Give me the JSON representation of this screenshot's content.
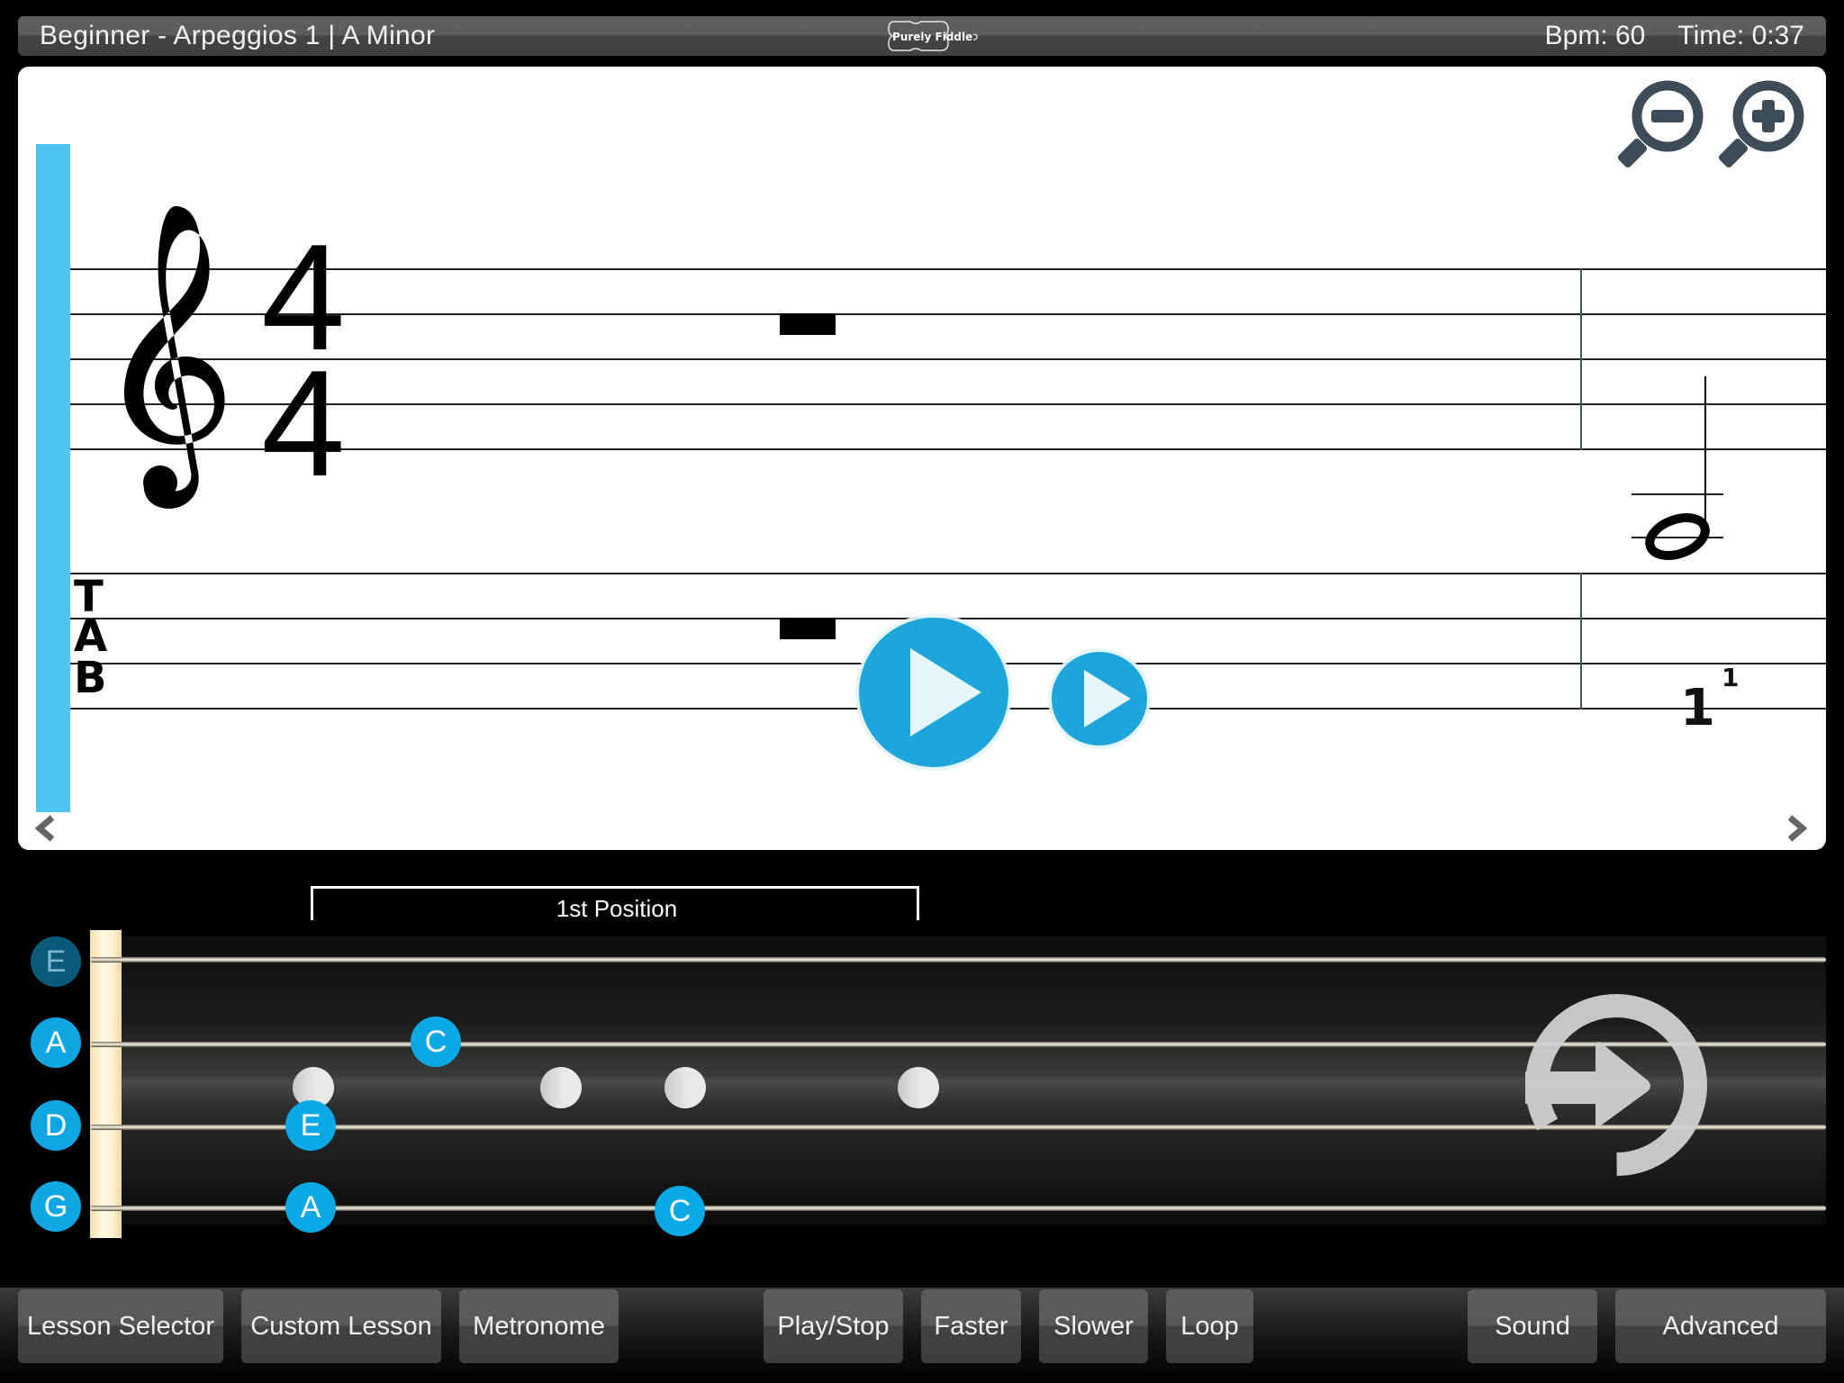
{
  "header": {
    "lesson_title": "Beginner - Arpeggios 1  |  A Minor",
    "logo_text": "Purely Fiddle",
    "bpm_label": "Bpm: 60",
    "time_label": "Time: 0:37"
  },
  "score": {
    "clef": "treble-clef",
    "time_signature": {
      "top": "4",
      "bottom": "4"
    },
    "tab_label": [
      "T",
      "A",
      "B"
    ],
    "measure1_rest": "whole-rest",
    "measure2_note": {
      "type": "half-note",
      "tab_fret": "1",
      "finger": "1"
    },
    "zoom_out_icon": "zoom-out-icon",
    "zoom_in_icon": "zoom-in-icon",
    "prev_icon": "chevron-left-icon",
    "next_icon": "chevron-right-icon",
    "play_icon": "play-icon",
    "play_slow_icon": "play-icon"
  },
  "fingerboard": {
    "position_label": "1st Position",
    "strings": [
      {
        "name": "E",
        "active": false
      },
      {
        "name": "A",
        "active": true
      },
      {
        "name": "D",
        "active": true
      },
      {
        "name": "G",
        "active": true
      }
    ],
    "notes": [
      {
        "string": "A",
        "label": "C"
      },
      {
        "string": "D",
        "label": "E"
      },
      {
        "string": "G",
        "label": "A"
      },
      {
        "string": "G",
        "label": "C"
      }
    ],
    "next_icon": "next-arrow-circle-icon"
  },
  "toolbar": {
    "lesson_selector": "Lesson Selector",
    "custom_lesson": "Custom Lesson",
    "metronome": "Metronome",
    "play_stop": "Play/Stop",
    "faster": "Faster",
    "slower": "Slower",
    "loop": "Loop",
    "sound": "Sound",
    "advanced": "Advanced"
  },
  "colors": {
    "accent": "#1ea5da",
    "playhead": "#4fc3f2",
    "note_marker": "#0aa9e6",
    "inactive_string": "#085a78"
  }
}
